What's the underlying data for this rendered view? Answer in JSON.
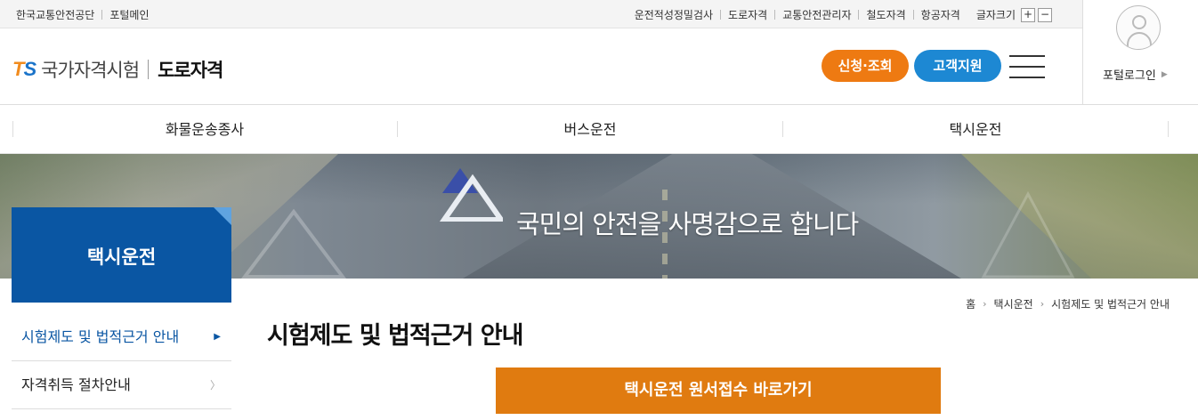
{
  "topbar": {
    "left_links": [
      "한국교통안전공단",
      "포털메인"
    ],
    "right_links": [
      "운전적성정밀검사",
      "도로자격",
      "교통안전관리자",
      "철도자격",
      "항공자격"
    ],
    "font_size_label": "글자크기",
    "font_plus": "+",
    "font_minus": "−"
  },
  "header": {
    "logo_ts_t": "T",
    "logo_ts_s": "S",
    "logo_name": "국가자격시험",
    "logo_sub": "도로자격",
    "apply_button": "신청·조회",
    "support_button": "고객지원",
    "menu_icon": "hamburger-icon"
  },
  "portal": {
    "login_label": "포털로그인",
    "avatar_icon": "user-icon"
  },
  "gnb": {
    "items": [
      "화물운송종사",
      "버스운전",
      "택시운전"
    ]
  },
  "banner": {
    "slogan": "국민의 안전을 사명감으로 합니다"
  },
  "sidebar": {
    "title": "택시운전",
    "items": [
      {
        "label": "시험제도 및 법적근거 안내",
        "active": true
      },
      {
        "label": "자격취득 절차안내",
        "active": false
      }
    ]
  },
  "breadcrumb": {
    "home": "홈",
    "items": [
      "택시운전",
      "시험제도 및 법적근거 안내"
    ]
  },
  "content": {
    "page_title": "시험제도 및 법적근거 안내",
    "cta_button": "택시운전 원서접수 바로가기"
  },
  "colors": {
    "accent_orange": "#ee7a12",
    "accent_blue": "#1d88d3",
    "sidebar_blue": "#0a56a3",
    "cta_orange": "#e07b10"
  }
}
